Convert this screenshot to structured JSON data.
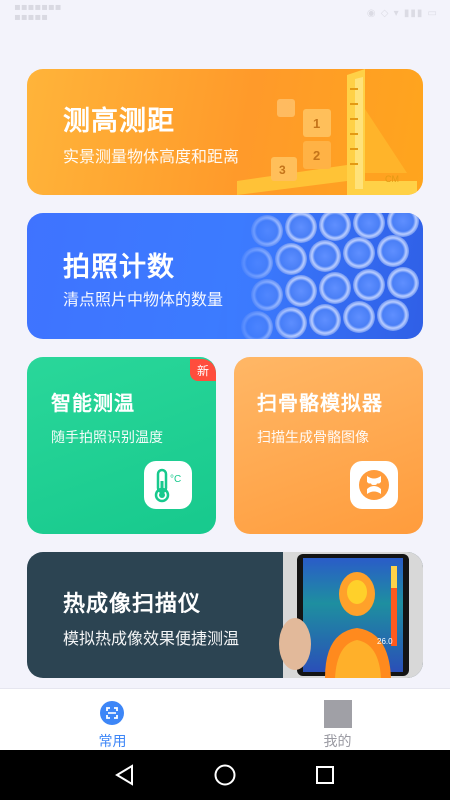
{
  "cards": {
    "measure": {
      "title": "测高测距",
      "subtitle": "实景测量物体高度和距离",
      "deco_numbers": [
        "1",
        "2",
        "3"
      ],
      "deco_unit": "CM"
    },
    "count": {
      "title": "拍照计数",
      "subtitle": "清点照片中物体的数量"
    },
    "temperature": {
      "title": "智能测温",
      "subtitle": "随手拍照识别温度",
      "badge": "新",
      "icon_unit": "°C"
    },
    "skeleton": {
      "title": "扫骨骼模拟器",
      "subtitle": "扫描生成骨骼图像"
    },
    "thermal": {
      "title": "热成像扫描仪",
      "subtitle": "模拟热成像效果便捷测温",
      "readout": "26.0"
    }
  },
  "bottom_nav": {
    "items": [
      {
        "label": "常用",
        "icon": "scan-icon",
        "active": true
      },
      {
        "label": "我的",
        "icon": "profile-placeholder-icon",
        "active": false
      }
    ]
  },
  "colors": {
    "accent": "#3d86f7",
    "card_orange": "#ff9a2a",
    "card_blue": "#3c7bff",
    "card_green": "#17c98d",
    "card_light_orange": "#ffa14a",
    "card_dark": "#2c4452",
    "badge_red": "#ff4d3d"
  }
}
